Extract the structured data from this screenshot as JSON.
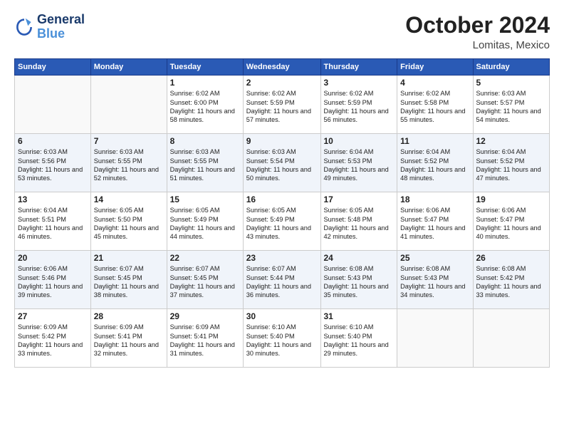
{
  "logo": {
    "line1": "General",
    "line2": "Blue"
  },
  "title": "October 2024",
  "location": "Lomitas, Mexico",
  "days_of_week": [
    "Sunday",
    "Monday",
    "Tuesday",
    "Wednesday",
    "Thursday",
    "Friday",
    "Saturday"
  ],
  "weeks": [
    [
      {
        "day": "",
        "info": ""
      },
      {
        "day": "",
        "info": ""
      },
      {
        "day": "1",
        "info": "Sunrise: 6:02 AM\nSunset: 6:00 PM\nDaylight: 11 hours and 58 minutes."
      },
      {
        "day": "2",
        "info": "Sunrise: 6:02 AM\nSunset: 5:59 PM\nDaylight: 11 hours and 57 minutes."
      },
      {
        "day": "3",
        "info": "Sunrise: 6:02 AM\nSunset: 5:59 PM\nDaylight: 11 hours and 56 minutes."
      },
      {
        "day": "4",
        "info": "Sunrise: 6:02 AM\nSunset: 5:58 PM\nDaylight: 11 hours and 55 minutes."
      },
      {
        "day": "5",
        "info": "Sunrise: 6:03 AM\nSunset: 5:57 PM\nDaylight: 11 hours and 54 minutes."
      }
    ],
    [
      {
        "day": "6",
        "info": "Sunrise: 6:03 AM\nSunset: 5:56 PM\nDaylight: 11 hours and 53 minutes."
      },
      {
        "day": "7",
        "info": "Sunrise: 6:03 AM\nSunset: 5:55 PM\nDaylight: 11 hours and 52 minutes."
      },
      {
        "day": "8",
        "info": "Sunrise: 6:03 AM\nSunset: 5:55 PM\nDaylight: 11 hours and 51 minutes."
      },
      {
        "day": "9",
        "info": "Sunrise: 6:03 AM\nSunset: 5:54 PM\nDaylight: 11 hours and 50 minutes."
      },
      {
        "day": "10",
        "info": "Sunrise: 6:04 AM\nSunset: 5:53 PM\nDaylight: 11 hours and 49 minutes."
      },
      {
        "day": "11",
        "info": "Sunrise: 6:04 AM\nSunset: 5:52 PM\nDaylight: 11 hours and 48 minutes."
      },
      {
        "day": "12",
        "info": "Sunrise: 6:04 AM\nSunset: 5:52 PM\nDaylight: 11 hours and 47 minutes."
      }
    ],
    [
      {
        "day": "13",
        "info": "Sunrise: 6:04 AM\nSunset: 5:51 PM\nDaylight: 11 hours and 46 minutes."
      },
      {
        "day": "14",
        "info": "Sunrise: 6:05 AM\nSunset: 5:50 PM\nDaylight: 11 hours and 45 minutes."
      },
      {
        "day": "15",
        "info": "Sunrise: 6:05 AM\nSunset: 5:49 PM\nDaylight: 11 hours and 44 minutes."
      },
      {
        "day": "16",
        "info": "Sunrise: 6:05 AM\nSunset: 5:49 PM\nDaylight: 11 hours and 43 minutes."
      },
      {
        "day": "17",
        "info": "Sunrise: 6:05 AM\nSunset: 5:48 PM\nDaylight: 11 hours and 42 minutes."
      },
      {
        "day": "18",
        "info": "Sunrise: 6:06 AM\nSunset: 5:47 PM\nDaylight: 11 hours and 41 minutes."
      },
      {
        "day": "19",
        "info": "Sunrise: 6:06 AM\nSunset: 5:47 PM\nDaylight: 11 hours and 40 minutes."
      }
    ],
    [
      {
        "day": "20",
        "info": "Sunrise: 6:06 AM\nSunset: 5:46 PM\nDaylight: 11 hours and 39 minutes."
      },
      {
        "day": "21",
        "info": "Sunrise: 6:07 AM\nSunset: 5:45 PM\nDaylight: 11 hours and 38 minutes."
      },
      {
        "day": "22",
        "info": "Sunrise: 6:07 AM\nSunset: 5:45 PM\nDaylight: 11 hours and 37 minutes."
      },
      {
        "day": "23",
        "info": "Sunrise: 6:07 AM\nSunset: 5:44 PM\nDaylight: 11 hours and 36 minutes."
      },
      {
        "day": "24",
        "info": "Sunrise: 6:08 AM\nSunset: 5:43 PM\nDaylight: 11 hours and 35 minutes."
      },
      {
        "day": "25",
        "info": "Sunrise: 6:08 AM\nSunset: 5:43 PM\nDaylight: 11 hours and 34 minutes."
      },
      {
        "day": "26",
        "info": "Sunrise: 6:08 AM\nSunset: 5:42 PM\nDaylight: 11 hours and 33 minutes."
      }
    ],
    [
      {
        "day": "27",
        "info": "Sunrise: 6:09 AM\nSunset: 5:42 PM\nDaylight: 11 hours and 33 minutes."
      },
      {
        "day": "28",
        "info": "Sunrise: 6:09 AM\nSunset: 5:41 PM\nDaylight: 11 hours and 32 minutes."
      },
      {
        "day": "29",
        "info": "Sunrise: 6:09 AM\nSunset: 5:41 PM\nDaylight: 11 hours and 31 minutes."
      },
      {
        "day": "30",
        "info": "Sunrise: 6:10 AM\nSunset: 5:40 PM\nDaylight: 11 hours and 30 minutes."
      },
      {
        "day": "31",
        "info": "Sunrise: 6:10 AM\nSunset: 5:40 PM\nDaylight: 11 hours and 29 minutes."
      },
      {
        "day": "",
        "info": ""
      },
      {
        "day": "",
        "info": ""
      }
    ]
  ]
}
